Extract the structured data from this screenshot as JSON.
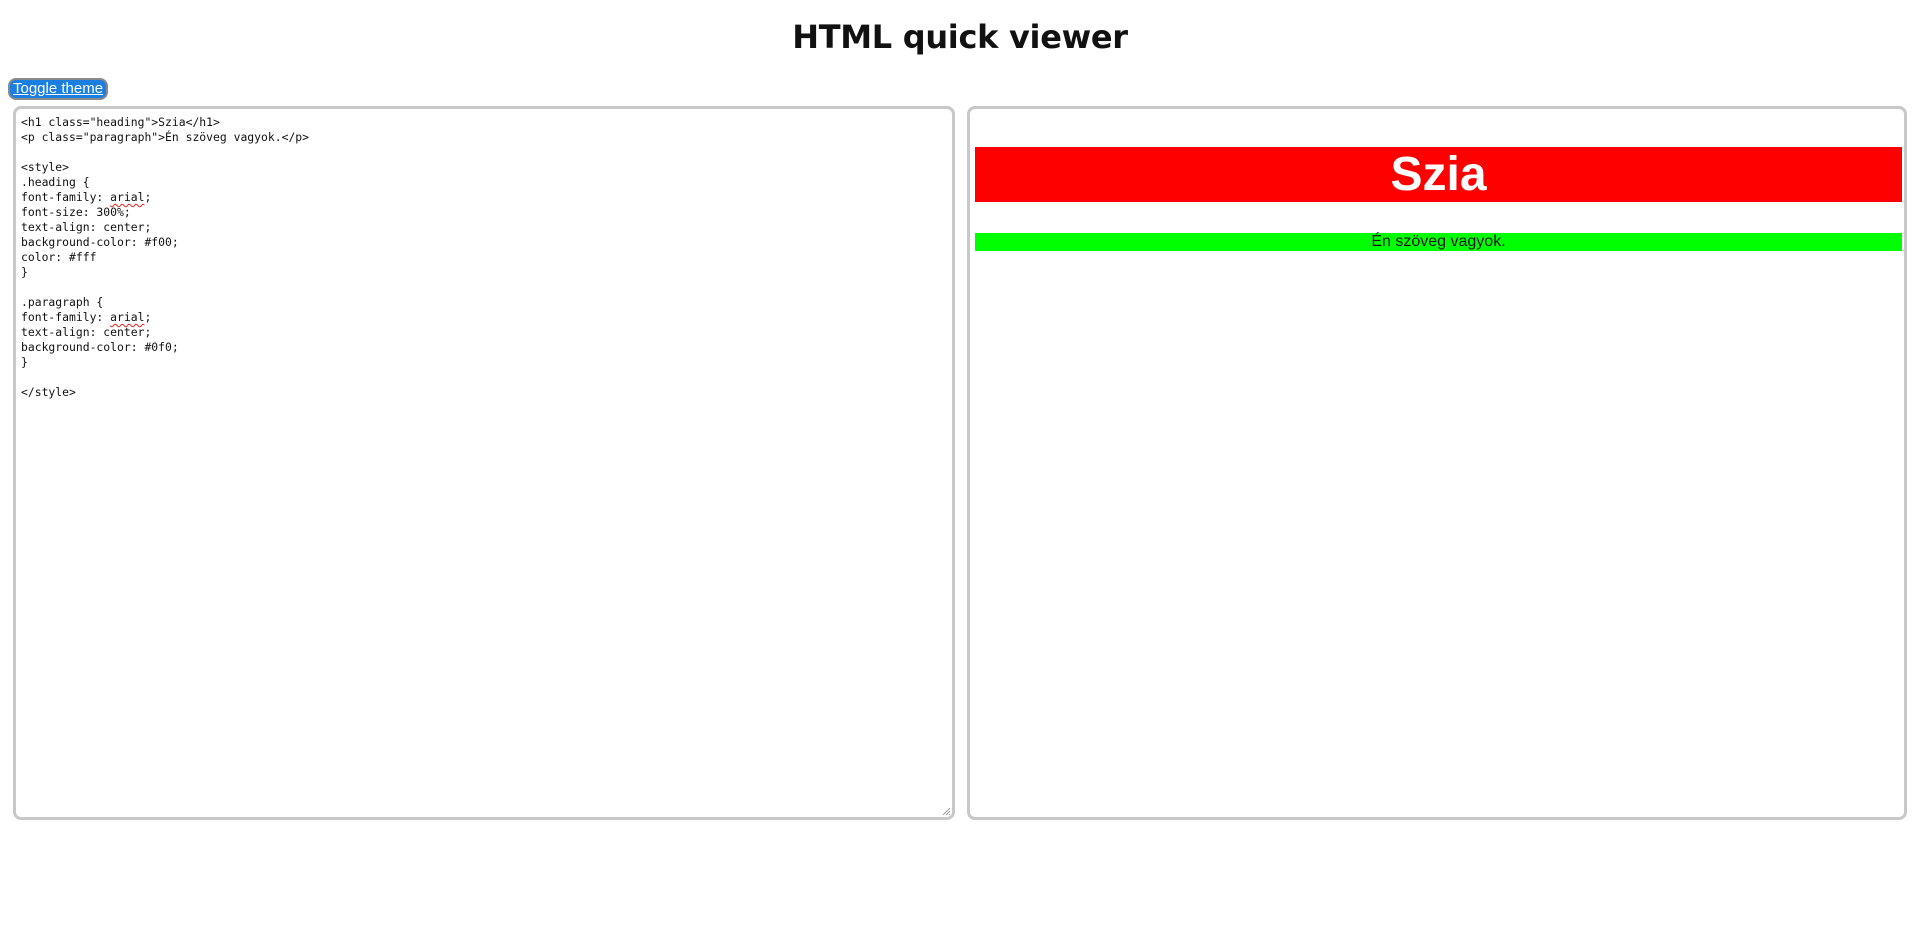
{
  "header": {
    "title": "HTML quick viewer"
  },
  "toolbar": {
    "toggle_theme_label": "Toggle theme"
  },
  "editor": {
    "lines": [
      "<h1 class=\"heading\">Szia</h1>",
      "<p class=\"paragraph\">Én szöveg vagyok.</p>",
      "",
      "<style>",
      ".heading {",
      "font-family: arial;",
      "font-size: 300%;",
      "text-align: center;",
      "background-color: #f00;",
      "color: #fff",
      "}",
      "",
      ".paragraph {",
      "font-family: arial;",
      "text-align: center;",
      "background-color: #0f0;",
      "}",
      "",
      "</style>"
    ],
    "spellcheck_word": "arial"
  },
  "preview": {
    "heading_text": "Szia",
    "paragraph_text": "Én szöveg vagyok.",
    "heading_bg": "#ff0000",
    "heading_color": "#ffffff",
    "paragraph_bg": "#00ff00"
  },
  "colors": {
    "toggle_button_bg": "#1a7fe0",
    "panel_border": "#c8c8c8",
    "spellcheck_underline": "#e02020"
  }
}
